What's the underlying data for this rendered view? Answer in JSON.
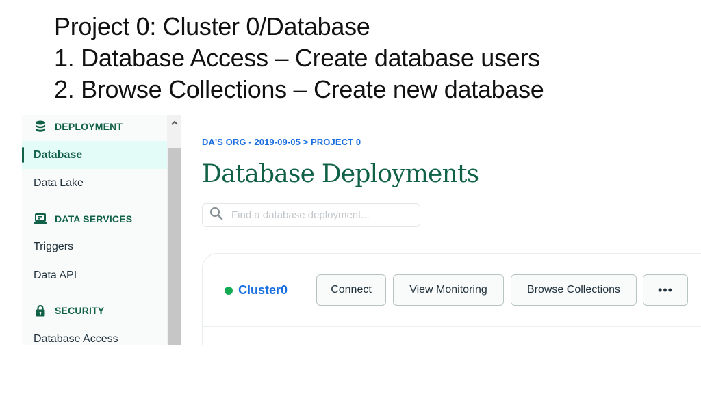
{
  "slide": {
    "title_lines": [
      "Project 0: Cluster 0/Database",
      "1. Database Access – Create database users",
      "2. Browse Collections – Create new database"
    ]
  },
  "sidebar": {
    "sections": [
      {
        "label": "DEPLOYMENT",
        "icon": "database-icon"
      },
      {
        "label": "DATA SERVICES",
        "icon": "laptop-icon"
      },
      {
        "label": "SECURITY",
        "icon": "lock-icon"
      }
    ],
    "items": [
      {
        "label": "Database",
        "active": true
      },
      {
        "label": "Data Lake"
      },
      {
        "label": "Triggers"
      },
      {
        "label": "Data API"
      },
      {
        "label": "Database Access"
      }
    ]
  },
  "main": {
    "breadcrumb": "DA'S ORG - 2019-09-05 > PROJECT 0",
    "title": "Database Deployments",
    "search": {
      "placeholder": "Find a database deployment...",
      "value": ""
    },
    "cluster": {
      "name": "Cluster0",
      "status_color": "#13aa52",
      "buttons": {
        "connect": "Connect",
        "view_monitoring": "View Monitoring",
        "browse_collections": "Browse Collections",
        "more": "•••"
      }
    }
  },
  "colors": {
    "brand_green": "#116149",
    "link_blue": "#1a6fe0",
    "active_bg": "#e3fcf7"
  }
}
